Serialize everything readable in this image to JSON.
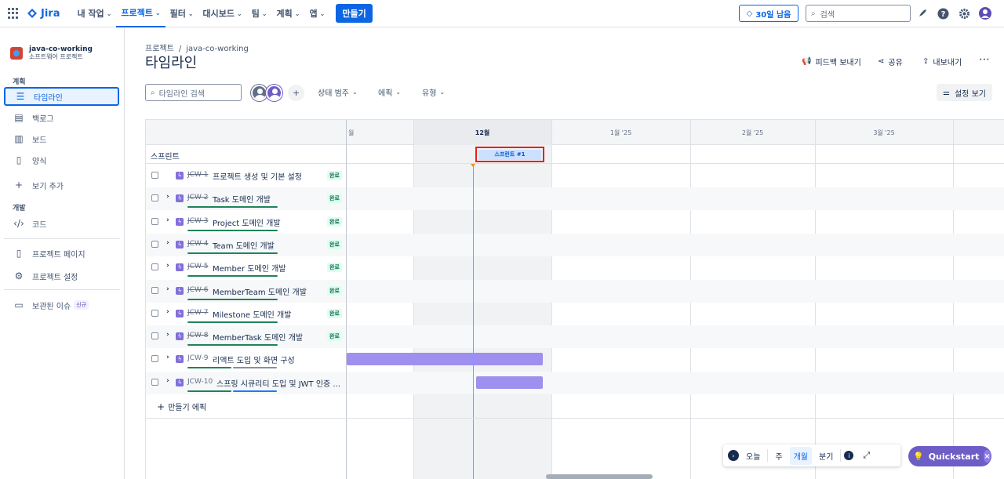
{
  "topnav": {
    "logo": "Jira",
    "items": [
      "내 작업",
      "프로젝트",
      "필터",
      "대시보드",
      "팀",
      "계획",
      "앱"
    ],
    "active_index": 1,
    "create": "만들기",
    "trial": "30일 남음",
    "search_placeholder": "검색"
  },
  "sidebar": {
    "project_name": "java-co-working",
    "project_type": "소프트웨어 프로젝트",
    "planning_label": "계획",
    "dev_label": "개발",
    "items": {
      "timeline": "타임라인",
      "backlog": "백로그",
      "board": "보드",
      "forms": "양식",
      "add_view": "보기 추가",
      "code": "코드",
      "project_pages": "프로젝트 페이지",
      "project_settings": "프로젝트 설정",
      "archived": "보관된 이슈",
      "new_badge": "신규"
    }
  },
  "header": {
    "breadcrumb_root": "프로젝트",
    "breadcrumb_project": "java-co-working",
    "title": "타임라인",
    "feedback": "피드백 보내기",
    "share": "공유",
    "export": "내보내기"
  },
  "toolbar": {
    "search_placeholder": "타임라인 검색",
    "status_filter": "상태 범주",
    "epic_filter": "에픽",
    "type_filter": "유형",
    "view_settings": "설정 보기"
  },
  "timeline": {
    "months": [
      "월",
      "12월",
      "1월 '25",
      "2월 '25",
      "3월 '25"
    ],
    "sprint_row_label": "스프린트",
    "sprint_chip": "스프린트 #1",
    "create_epic": "만들기 에픽",
    "done_label": "완료",
    "epics": [
      {
        "key": "JCW-1",
        "summary": "프로젝트 생성 및 기본 설정",
        "done": true,
        "expandable": false
      },
      {
        "key": "JCW-2",
        "summary": "Task 도메인 개발",
        "done": true,
        "expandable": true
      },
      {
        "key": "JCW-3",
        "summary": "Project 도메인 개발",
        "done": true,
        "expandable": true
      },
      {
        "key": "JCW-4",
        "summary": "Team 도메인 개발",
        "done": true,
        "expandable": true
      },
      {
        "key": "JCW-5",
        "summary": "Member 도메인 개발",
        "done": true,
        "expandable": true
      },
      {
        "key": "JCW-6",
        "summary": "MemberTeam 도메인 개발",
        "done": true,
        "expandable": true
      },
      {
        "key": "JCW-7",
        "summary": "Milestone 도메인 개발",
        "done": true,
        "expandable": true
      },
      {
        "key": "JCW-8",
        "summary": "MemberTask 도메인 개발",
        "done": true,
        "expandable": true
      },
      {
        "key": "JCW-9",
        "summary": "리액트 도입 및 화면 구성",
        "done": false,
        "expandable": true
      },
      {
        "key": "JCW-10",
        "summary": "스프링 시큐리티 도입 및 JWT 인증 ...",
        "done": false,
        "expandable": true
      }
    ]
  },
  "zoom": {
    "today": "오늘",
    "week": "주",
    "month": "개월",
    "quarter": "분기",
    "selected": "개월"
  },
  "quickstart": "Quickstart",
  "colors": {
    "accent": "#0c66e4",
    "epic": "#8270db",
    "bar": "#9f8fef",
    "today": "#f18d13",
    "done_progress": "#1f845a",
    "inprogress_progress": "#1d7afc"
  }
}
